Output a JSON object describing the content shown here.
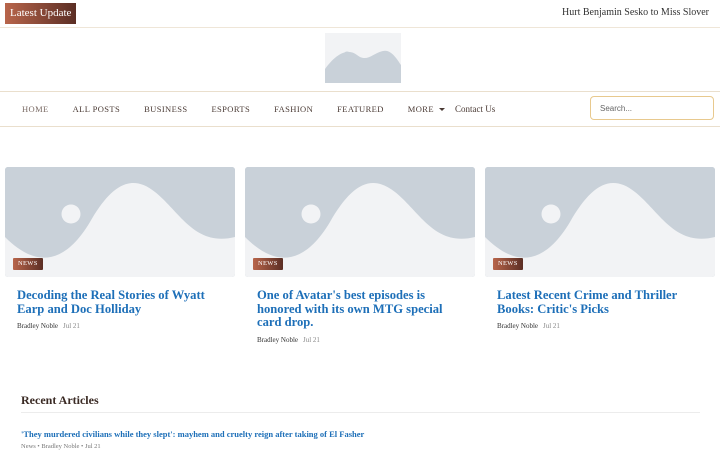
{
  "topbar": {
    "badge": "Latest Update",
    "ticker": "Hurt Benjamin Sesko to Miss Slover"
  },
  "logo": {
    "icon": "image-placeholder-icon"
  },
  "nav": {
    "items": [
      "HOME",
      "ALL POSTS",
      "BUSINESS",
      "ESPORTS",
      "FASHION",
      "FEATURED",
      "MORE"
    ],
    "contact": "Contact Us"
  },
  "search": {
    "placeholder": "Search..."
  },
  "cards": [
    {
      "category": "NEWS",
      "title": "Decoding the Real Stories of Wyatt Earp and Doc Holliday",
      "author": "Bradley Noble",
      "date": "Jul 21"
    },
    {
      "category": "NEWS",
      "title": "One of Avatar's best episodes is honored with its own MTG special card drop.",
      "author": "Bradley Noble",
      "date": "Jul 21"
    },
    {
      "category": "NEWS",
      "title": "Latest Recent Crime and Thriller Books: Critic's Picks",
      "author": "Bradley Noble",
      "date": "Jul 21"
    }
  ],
  "recent": {
    "heading": "Recent Articles",
    "items": [
      {
        "title": "'They murdered civilians while they slept': mayhem and cruelty reign after taking of El Fasher",
        "meta": "News • Bradley Noble • Jul 21"
      }
    ]
  },
  "colors": {
    "accent": "#b8654b",
    "accent_dark": "#5b2e24",
    "link": "#1d6fb8",
    "placeholder_bg": "#c9d1d9"
  }
}
